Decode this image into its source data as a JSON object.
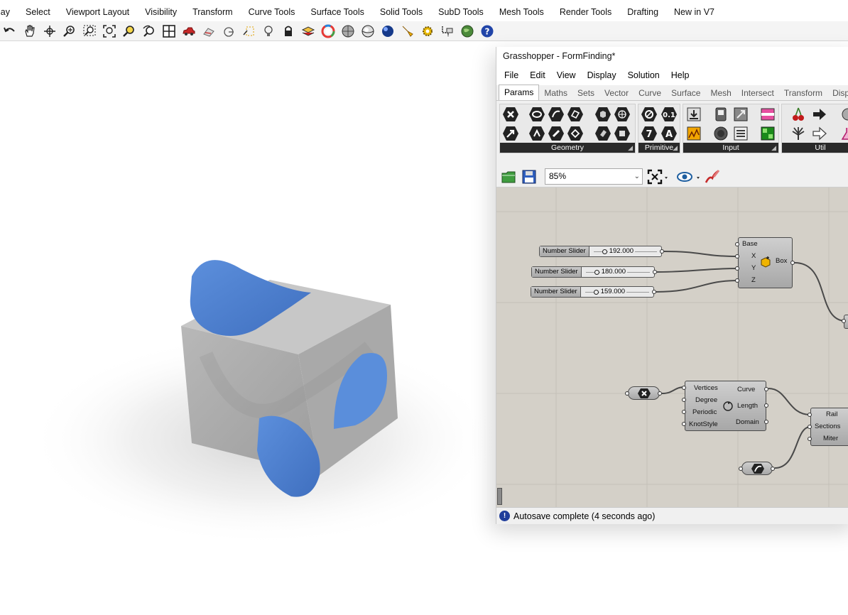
{
  "rhino": {
    "menu": [
      "lay",
      "Select",
      "Viewport Layout",
      "Visibility",
      "Transform",
      "Curve Tools",
      "Surface Tools",
      "Solid Tools",
      "SubD Tools",
      "Mesh Tools",
      "Render Tools",
      "Drafting",
      "New in V7"
    ],
    "toolbar_icons": [
      "undo-icon",
      "pan-hand-icon",
      "rotate-view-icon",
      "zoom-icon",
      "zoom-window-icon",
      "zoom-extents-icon",
      "zoom-selected-icon",
      "undo-view-icon",
      "four-viewports-icon",
      "car-icon",
      "named-view-icon",
      "grid-snap-icon",
      "cplane-icon",
      "light-icon",
      "lock-icon",
      "layer-icon",
      "color-wheel-icon",
      "shaded-sphere-icon",
      "rendered-sphere-icon",
      "blue-sphere-icon",
      "flashlight-icon",
      "gear-options-icon",
      "grasshopper-command-icon",
      "globe-icon",
      "help-icon"
    ]
  },
  "grasshopper": {
    "title": "Grasshopper - FormFinding*",
    "menu": [
      "File",
      "Edit",
      "View",
      "Display",
      "Solution",
      "Help"
    ],
    "tabs": [
      "Params",
      "Maths",
      "Sets",
      "Vector",
      "Curve",
      "Surface",
      "Mesh",
      "Intersect",
      "Transform",
      "Displ"
    ],
    "active_tab": "Params",
    "panels": [
      "Geometry",
      "Primitive",
      "Input",
      "Util"
    ],
    "zoom": "85%",
    "status": "Autosave complete (4 seconds ago)",
    "sliders": [
      {
        "label": "Number Slider",
        "value": "192.000",
        "fraction": 0.35
      },
      {
        "label": "Number Slider",
        "value": "180.000",
        "fraction": 0.12
      },
      {
        "label": "Number Slider",
        "value": "159.000",
        "fraction": 0.14
      }
    ],
    "box": {
      "inputs": [
        "Base",
        "X",
        "Y",
        "Z"
      ],
      "output": "Box"
    },
    "polyline": {
      "inputs": [
        "Vertices",
        "Degree",
        "Periodic",
        "KnotStyle"
      ],
      "outputs": [
        "Curve",
        "Length",
        "Domain"
      ]
    },
    "sweep": {
      "inputs": [
        "Rail",
        "Sections",
        "Miter"
      ]
    }
  }
}
